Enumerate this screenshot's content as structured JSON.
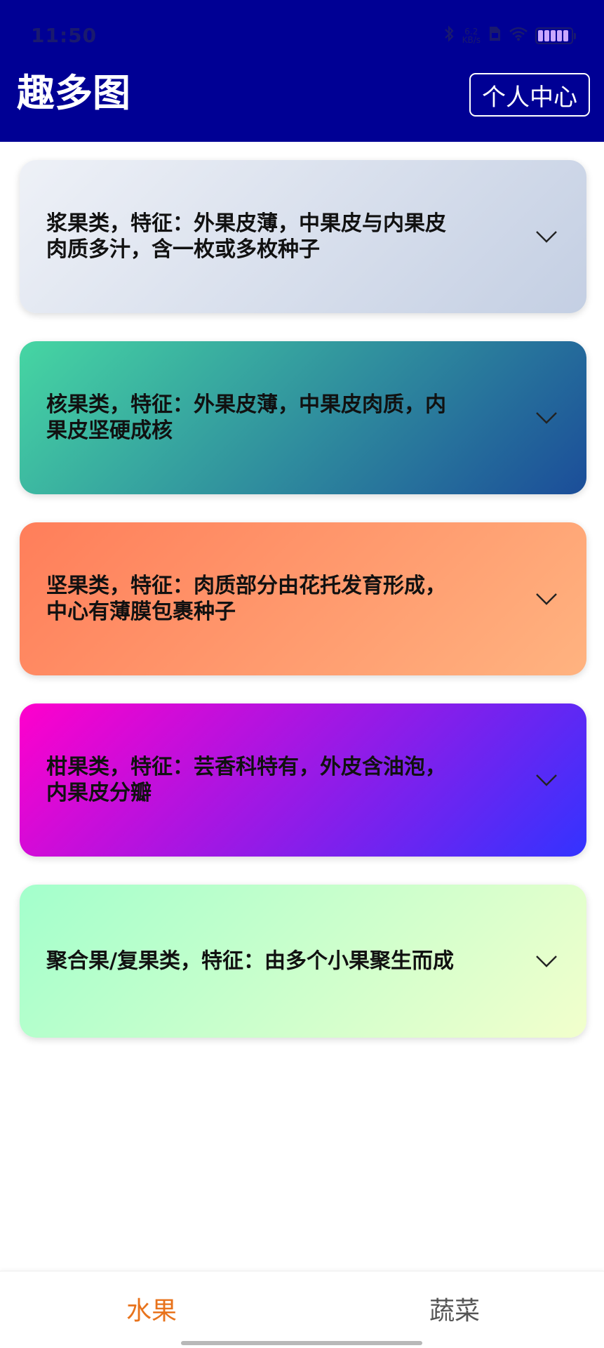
{
  "colors": {
    "header_bg": "#000094",
    "active_tab": "#e8731c",
    "inactive_tab": "#555555"
  },
  "status_bar": {
    "time": "11:50",
    "icons": [
      "bluetooth-icon",
      "signal-icon",
      "sim-icon",
      "wifi-icon",
      "battery-icon"
    ],
    "network_label_top": "6.2",
    "network_label_bottom": "KB/s"
  },
  "header": {
    "title": "趣多图",
    "profile_button": "个人中心"
  },
  "cards": [
    {
      "text": "浆果类，特征：外果皮薄，中果皮与内果皮肉质多汁，含一枚或多枚种子",
      "gradient": [
        "#eef1f7",
        "#c4cfe3"
      ],
      "icon": "chevron-down-icon"
    },
    {
      "text": "核果类，特征：外果皮薄，中果皮肉质，内果皮坚硬成核",
      "gradient": [
        "#46d6a3",
        "#1b4d99"
      ],
      "icon": "chevron-down-icon"
    },
    {
      "text": "坚果类，特征：肉质部分由花托发育形成，中心有薄膜包裹种子",
      "gradient": [
        "#ff7e5a",
        "#ffb380"
      ],
      "icon": "chevron-down-icon"
    },
    {
      "text": "柑果类，特征：芸香科特有，外皮含油泡，内果皮分瓣",
      "gradient": [
        "#ff00cc",
        "#3333ff"
      ],
      "icon": "chevron-down-icon"
    },
    {
      "text": "聚合果/复果类，特征：由多个小果聚生而成",
      "gradient": [
        "#a3ffcc",
        "#f2ffcc"
      ],
      "icon": "chevron-down-icon"
    }
  ],
  "bottom_nav": {
    "tabs": [
      {
        "label": "水果",
        "active": true
      },
      {
        "label": "蔬菜",
        "active": false
      }
    ]
  }
}
